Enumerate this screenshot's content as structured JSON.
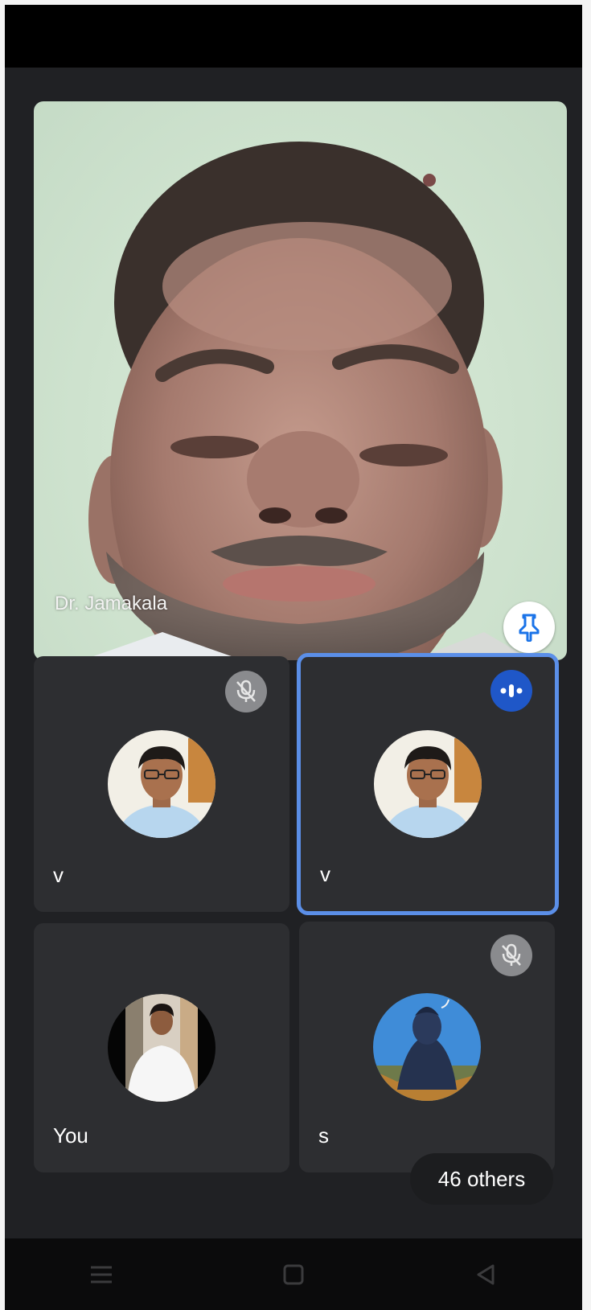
{
  "main_participant": {
    "name": "Dr. Jamakala"
  },
  "participants": [
    {
      "name": "v",
      "mic": "muted"
    },
    {
      "name": "v",
      "mic": "speaking"
    },
    {
      "name": "You",
      "mic": "none"
    },
    {
      "name": "s",
      "mic": "muted"
    }
  ],
  "others_label": "46 others",
  "icons": {
    "pin": "pin-icon",
    "mic_off": "mic-off-icon",
    "speaking": "speaking-indicator-icon",
    "nav_menu": "menu-icon",
    "nav_home": "square-home-icon",
    "nav_back": "triangle-back-icon"
  },
  "colors": {
    "background": "#202124",
    "tile": "#2d2e31",
    "active_border": "#5b8fe8",
    "speaking": "#1f57c8",
    "pin_icon": "#1a73e8"
  }
}
